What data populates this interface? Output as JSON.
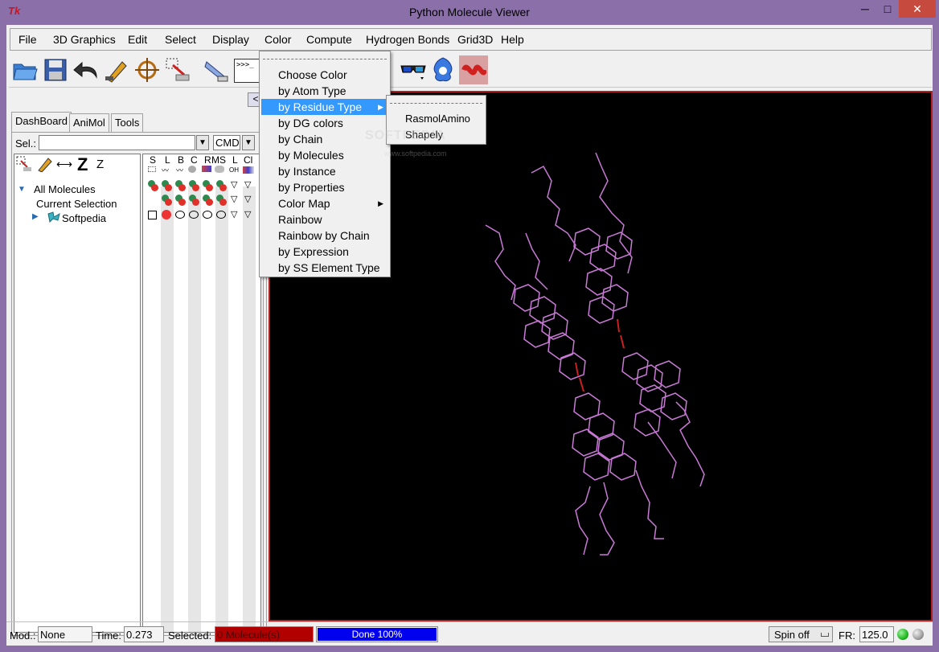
{
  "window": {
    "title": "Python Molecule Viewer",
    "icon_text": "Tk",
    "minimize": "─",
    "maximize": "□",
    "close": "✕"
  },
  "menubar": [
    "File",
    "3D Graphics",
    "Edit",
    "Select",
    "Display",
    "Color",
    "Compute",
    "Hydrogen Bonds",
    "Grid3D",
    "Help"
  ],
  "toolbar": {
    "icons": [
      "open-folder-icon",
      "save-disk-icon",
      "undo-arrow-icon",
      "selection-pencil-icon",
      "crosshair-pick-icon",
      "select-region-icon",
      "bond-tool-icon",
      "python-shell-icon",
      "stereo-glasses-icon",
      "surface-blob-icon",
      "ribbon-icon"
    ],
    "shell_label": ">>>_"
  },
  "left_panel": {
    "tabs": [
      "DashBoard",
      "AniMol",
      "Tools"
    ],
    "sel_label": "Sel.:",
    "sel_value": "",
    "cmd_value": "CMD",
    "toolbar_letters": [
      "Z",
      "Z"
    ],
    "tree": [
      {
        "label": "All Molecules"
      },
      {
        "label": "Current Selection"
      },
      {
        "label": "Softpedia"
      }
    ],
    "columns": [
      "S",
      "L",
      "B",
      "C",
      "R",
      "MS",
      "L",
      "Cl"
    ],
    "column_subicons": [
      "dotted-box-icon",
      "line-icon",
      "ball-stick-icon",
      "cpk-icon",
      "ribbon-small-icon",
      "surface-small-icon",
      "oh-label-icon",
      "color-flag-icon"
    ],
    "oh_label": "OH"
  },
  "color_menu": {
    "items": [
      "Choose Color",
      "by Atom Type",
      "by Residue Type",
      "by DG colors",
      "by Chain",
      "by Molecules",
      "by Instance",
      "by Properties",
      "Color Map",
      "Rainbow",
      "Rainbow by Chain",
      "by Expression",
      "by SS Element Type"
    ],
    "highlighted": "by Residue Type",
    "has_submenu": [
      "by Residue Type",
      "Color Map"
    ]
  },
  "residue_submenu": {
    "items": [
      "RasmolAmino",
      "Shapely"
    ]
  },
  "watermark": {
    "text": "SOFTPEDIA",
    "url": "www.softpedia.com"
  },
  "status": {
    "mod_label": "Mod.:",
    "mod_value": "None",
    "time_label": "Time:",
    "time_value": "0.273",
    "selected_label": "Selected:",
    "selected_value": "0 Molecule(s)",
    "progress_text": "Done 100%",
    "progress_fraction": 1.0,
    "spin_value": "Spin off",
    "fr_label": "FR:",
    "fr_value": "125.0",
    "colors": {
      "selected_bg": "#b00000",
      "progress": "#0000ee",
      "led_green": "#22bb22",
      "led_gray": "#a0a0a0"
    }
  },
  "colors": {
    "molecule": "#c87ad6",
    "bond_red": "#cc2020",
    "viewer_bg": "#000000",
    "frame_border": "#b02020"
  }
}
